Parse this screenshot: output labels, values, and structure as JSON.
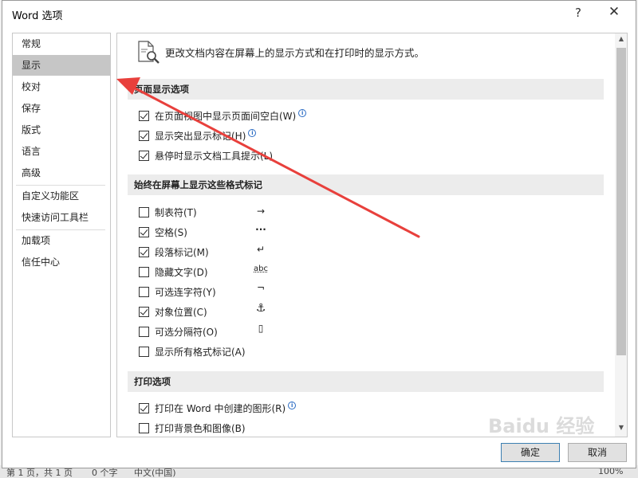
{
  "window": {
    "title": "Word 选项",
    "help_glyph": "?",
    "close_glyph": "✕"
  },
  "nav": {
    "items": [
      {
        "label": "常规"
      },
      {
        "label": "显示"
      },
      {
        "label": "校对"
      },
      {
        "label": "保存"
      },
      {
        "label": "版式"
      },
      {
        "label": "语言"
      },
      {
        "label": "高级"
      },
      {
        "label": "自定义功能区"
      },
      {
        "label": "快速访问工具栏"
      },
      {
        "label": "加载项"
      },
      {
        "label": "信任中心"
      }
    ],
    "selected": "显示"
  },
  "content": {
    "header_text": "更改文档内容在屏幕上的显示方式和在打印时的显示方式。",
    "sections": [
      {
        "title": "页面显示选项",
        "options": [
          {
            "label": "在页面视图中显示页面间空白(W)",
            "checked": true,
            "info": true
          },
          {
            "label": "显示突出显示标记(H)",
            "checked": true,
            "info": true
          },
          {
            "label": "悬停时显示文档工具提示(L)",
            "checked": true,
            "info": false
          }
        ]
      },
      {
        "title": "始终在屏幕上显示这些格式标记",
        "options": [
          {
            "label": "制表符(T)",
            "checked": false,
            "symbol": "→"
          },
          {
            "label": "空格(S)",
            "checked": true,
            "symbol": "···"
          },
          {
            "label": "段落标记(M)",
            "checked": true,
            "symbol": "↵"
          },
          {
            "label": "隐藏文字(D)",
            "checked": false,
            "symbol": "abc"
          },
          {
            "label": "可选连字符(Y)",
            "checked": false,
            "symbol": "¬"
          },
          {
            "label": "对象位置(C)",
            "checked": true,
            "symbol": "⚓"
          },
          {
            "label": "可选分隔符(O)",
            "checked": false,
            "symbol": "▯"
          },
          {
            "label": "显示所有格式标记(A)",
            "checked": false
          }
        ]
      },
      {
        "title": "打印选项",
        "options": [
          {
            "label": "打印在 Word 中创建的图形(R)",
            "checked": true,
            "info": true
          },
          {
            "label": "打印背景色和图像(B)",
            "checked": false,
            "info": false
          }
        ]
      }
    ]
  },
  "buttons": {
    "ok": "确定",
    "cancel": "取消"
  },
  "status_bar": {
    "pages": "第 1 页，共 1 页",
    "words": "0 个字",
    "language": "中文(中国)",
    "zoom": "100%"
  },
  "watermark": "Baidu 经验",
  "colors": {
    "arrow": "#e8403c",
    "selected_nav": "#c6c6c6",
    "info_blue": "#2b6cc4"
  }
}
